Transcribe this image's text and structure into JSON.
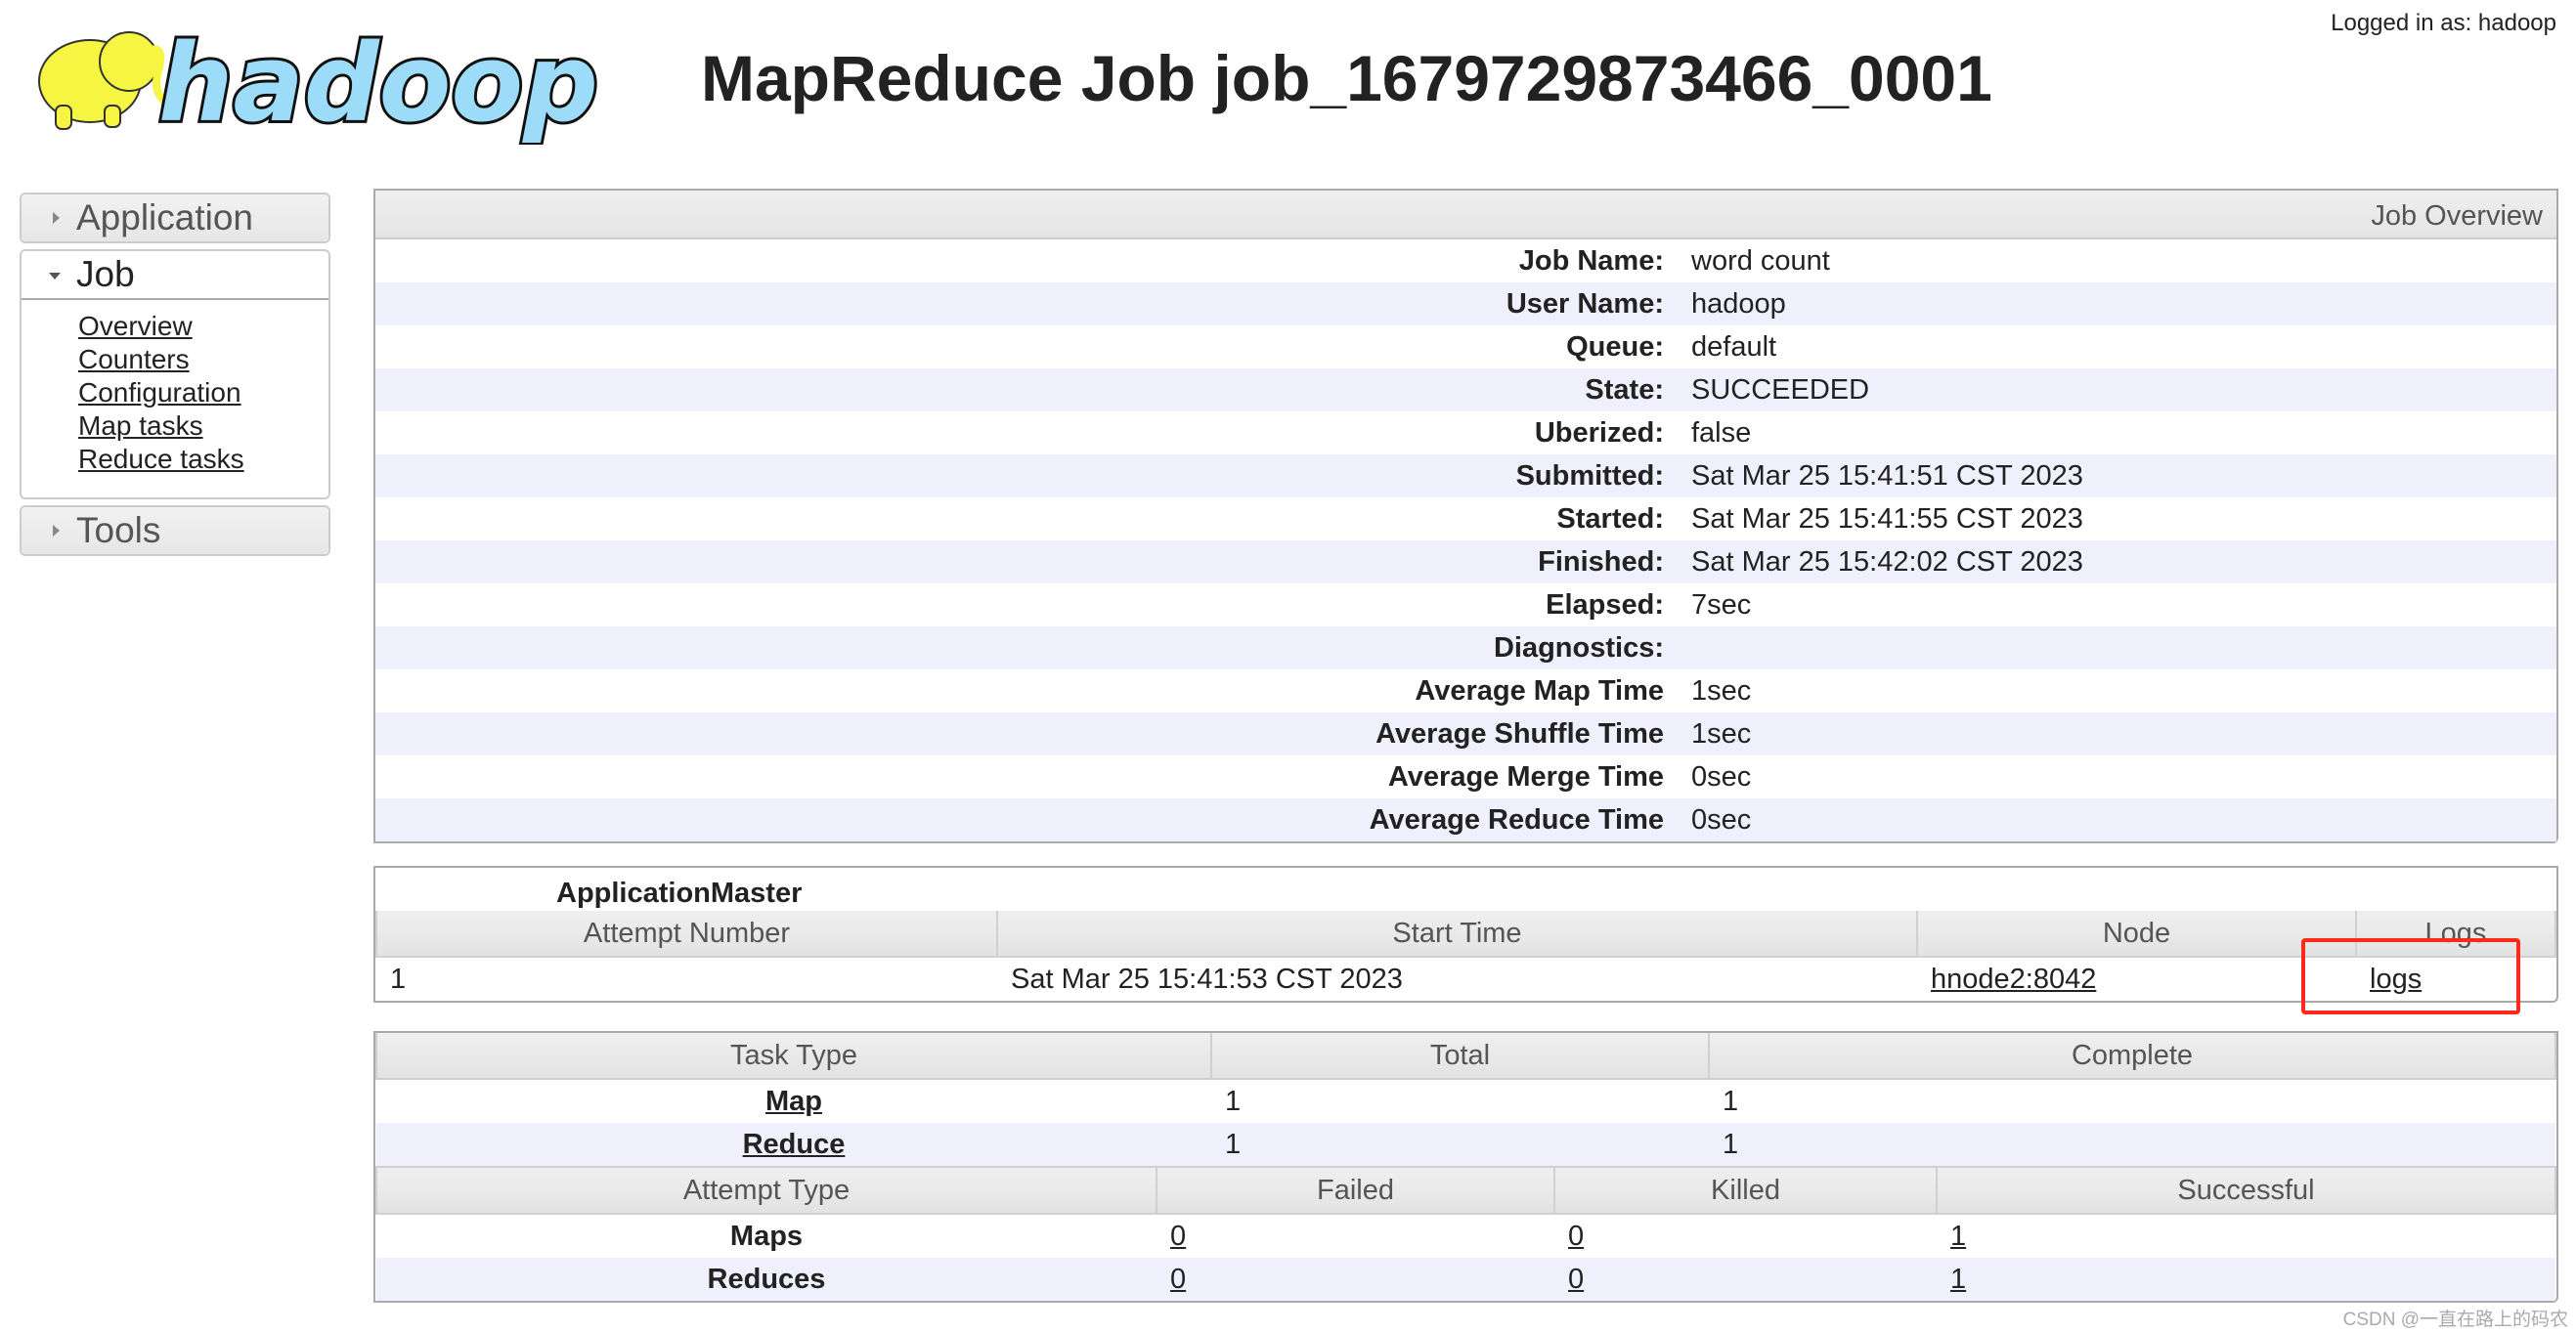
{
  "header": {
    "logo_text": "hadoop",
    "title": "MapReduce Job job_1679729873466_0001",
    "logged_in": "Logged in as: hadoop"
  },
  "nav": {
    "application": "Application",
    "job": "Job",
    "tools": "Tools",
    "job_links": [
      "Overview",
      "Counters",
      "Configuration",
      "Map tasks",
      "Reduce tasks"
    ]
  },
  "overview": {
    "heading": "Job Overview",
    "rows": [
      {
        "k": "Job Name:",
        "v": "word count"
      },
      {
        "k": "User Name:",
        "v": "hadoop"
      },
      {
        "k": "Queue:",
        "v": "default"
      },
      {
        "k": "State:",
        "v": "SUCCEEDED"
      },
      {
        "k": "Uberized:",
        "v": "false"
      },
      {
        "k": "Submitted:",
        "v": "Sat Mar 25 15:41:51 CST 2023"
      },
      {
        "k": "Started:",
        "v": "Sat Mar 25 15:41:55 CST 2023"
      },
      {
        "k": "Finished:",
        "v": "Sat Mar 25 15:42:02 CST 2023"
      },
      {
        "k": "Elapsed:",
        "v": "7sec"
      },
      {
        "k": "Diagnostics:",
        "v": ""
      },
      {
        "k": "Average Map Time",
        "v": "1sec"
      },
      {
        "k": "Average Shuffle Time",
        "v": "1sec"
      },
      {
        "k": "Average Merge Time",
        "v": "0sec"
      },
      {
        "k": "Average Reduce Time",
        "v": "0sec"
      }
    ]
  },
  "am": {
    "caption": "ApplicationMaster",
    "columns": [
      "Attempt Number",
      "Start Time",
      "Node",
      "Logs"
    ],
    "row": {
      "attempt": "1",
      "start": "Sat Mar 25 15:41:53 CST 2023",
      "node": "hnode2:8042",
      "logs": "logs"
    }
  },
  "tasks": {
    "columns": [
      "Task Type",
      "Total",
      "Complete"
    ],
    "rows": [
      {
        "type": "Map",
        "total": "1",
        "complete": "1"
      },
      {
        "type": "Reduce",
        "total": "1",
        "complete": "1"
      }
    ],
    "attempt_columns": [
      "Attempt Type",
      "Failed",
      "Killed",
      "Successful"
    ],
    "attempt_rows": [
      {
        "type": "Maps",
        "failed": "0",
        "killed": "0",
        "successful": "1"
      },
      {
        "type": "Reduces",
        "failed": "0",
        "killed": "0",
        "successful": "1"
      }
    ]
  },
  "highlight_color": "#ff2a1a",
  "watermark": "CSDN @一直在路上的码农"
}
